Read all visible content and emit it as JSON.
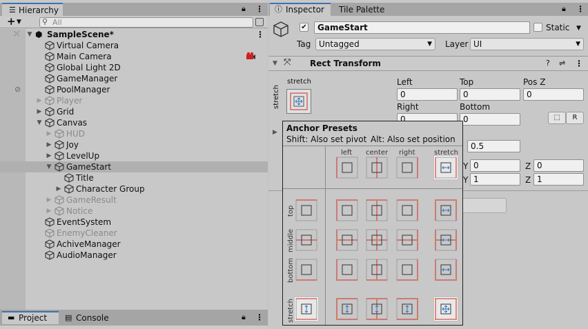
{
  "hierarchy": {
    "tab_label": "Hierarchy",
    "search_placeholder": "All",
    "add_label": "+",
    "items": [
      {
        "label": "SampleScene*"
      },
      {
        "label": "Virtual Camera"
      },
      {
        "label": "Main Camera"
      },
      {
        "label": "Global Light 2D"
      },
      {
        "label": "GameManager"
      },
      {
        "label": "PoolManager"
      },
      {
        "label": "Player"
      },
      {
        "label": "Grid"
      },
      {
        "label": "Canvas"
      },
      {
        "label": "HUD"
      },
      {
        "label": "Joy"
      },
      {
        "label": "LevelUp"
      },
      {
        "label": "GameStart"
      },
      {
        "label": "Title"
      },
      {
        "label": "Character Group"
      },
      {
        "label": "GameResult"
      },
      {
        "label": "Notice"
      },
      {
        "label": "EventSystem"
      },
      {
        "label": "EnemyCleaner"
      },
      {
        "label": "AchiveManager"
      },
      {
        "label": "AudioManager"
      }
    ]
  },
  "inspector": {
    "tab_label": "Inspector",
    "tab2_label": "Tile Palette",
    "object_name": "GameStart",
    "static_label": "Static",
    "tag_label": "Tag",
    "tag_value": "Untagged",
    "layer_label": "Layer",
    "layer_value": "UI",
    "component_title": "Rect Transform",
    "anchor_label_top": "stretch",
    "anchor_label_side": "stretch",
    "fields": {
      "left_label": "Left",
      "left_value": "0",
      "top_label": "Top",
      "top_value": "0",
      "posz_label": "Pos Z",
      "posz_value": "0",
      "right_label": "Right",
      "right_value": "0",
      "bottom_label": "Bottom",
      "bottom_value": "0",
      "pivot_partial": "0.5",
      "y1_label": "Y",
      "y1_value": "0",
      "z1_label": "Z",
      "z1_value": "0",
      "y2_label": "Y",
      "y2_value": "1",
      "z2_label": "Z",
      "z2_value": "1",
      "r_button": "R"
    }
  },
  "popup": {
    "title": "Anchor Presets",
    "shift_hint": "Shift: Also set pivot",
    "alt_hint": "Alt: Also set position",
    "col_labels": [
      "left",
      "center",
      "right",
      "stretch"
    ],
    "row_labels": [
      "top",
      "middle",
      "bottom",
      "stretch"
    ]
  },
  "bottom": {
    "tab1": "Project",
    "tab2": "Console"
  },
  "colors": {
    "accent": "#3a72b0",
    "anchor_red": "#d02a2a",
    "anchor_blue": "#2a78c8",
    "selection": "#b0b0b0"
  }
}
